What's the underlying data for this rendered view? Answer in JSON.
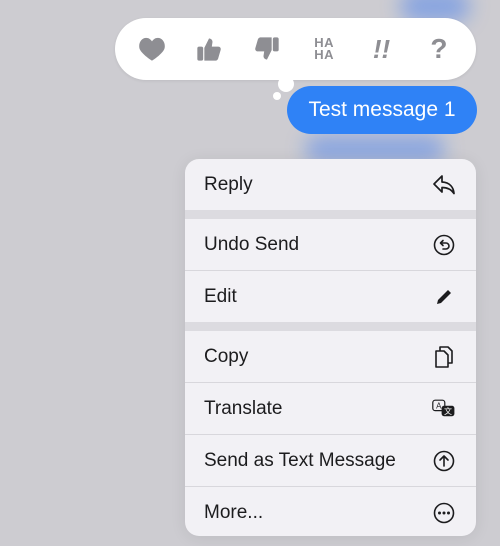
{
  "tapbacks": [
    {
      "name": "heart-icon"
    },
    {
      "name": "thumbs-up-icon"
    },
    {
      "name": "thumbs-down-icon"
    },
    {
      "name": "haha-icon",
      "label_top": "HA",
      "label_bottom": "HA"
    },
    {
      "name": "exclamation-icon",
      "label": "!!"
    },
    {
      "name": "question-icon",
      "label": "?"
    }
  ],
  "message": {
    "text": "Test message 1"
  },
  "menu": {
    "reply": "Reply",
    "undo_send": "Undo Send",
    "edit": "Edit",
    "copy": "Copy",
    "translate": "Translate",
    "send_as_text": "Send as Text Message",
    "more": "More..."
  },
  "colors": {
    "accent": "#2f82f6",
    "icon_gray": "#8e8e93"
  }
}
